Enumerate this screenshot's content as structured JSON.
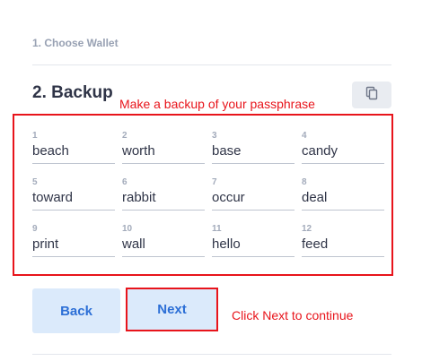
{
  "steps": {
    "step1_title": "1. Choose Wallet",
    "step2_title": "2. Backup"
  },
  "annotations": {
    "backup_note": "Make a backup of your passphrase",
    "next_note": "Click Next to continue"
  },
  "copy_button": {
    "icon": "copy-icon"
  },
  "passphrase": [
    {
      "num": "1",
      "word": "beach"
    },
    {
      "num": "2",
      "word": "worth"
    },
    {
      "num": "3",
      "word": "base"
    },
    {
      "num": "4",
      "word": "candy"
    },
    {
      "num": "5",
      "word": "toward"
    },
    {
      "num": "6",
      "word": "rabbit"
    },
    {
      "num": "7",
      "word": "occur"
    },
    {
      "num": "8",
      "word": "deal"
    },
    {
      "num": "9",
      "word": "print"
    },
    {
      "num": "10",
      "word": "wall"
    },
    {
      "num": "11",
      "word": "hello"
    },
    {
      "num": "12",
      "word": "feed"
    }
  ],
  "buttons": {
    "back_label": "Back",
    "next_label": "Next"
  },
  "colors": {
    "annotation_red": "#e8141b",
    "button_bg": "#dbeafb",
    "button_text": "#2c6fd6"
  }
}
